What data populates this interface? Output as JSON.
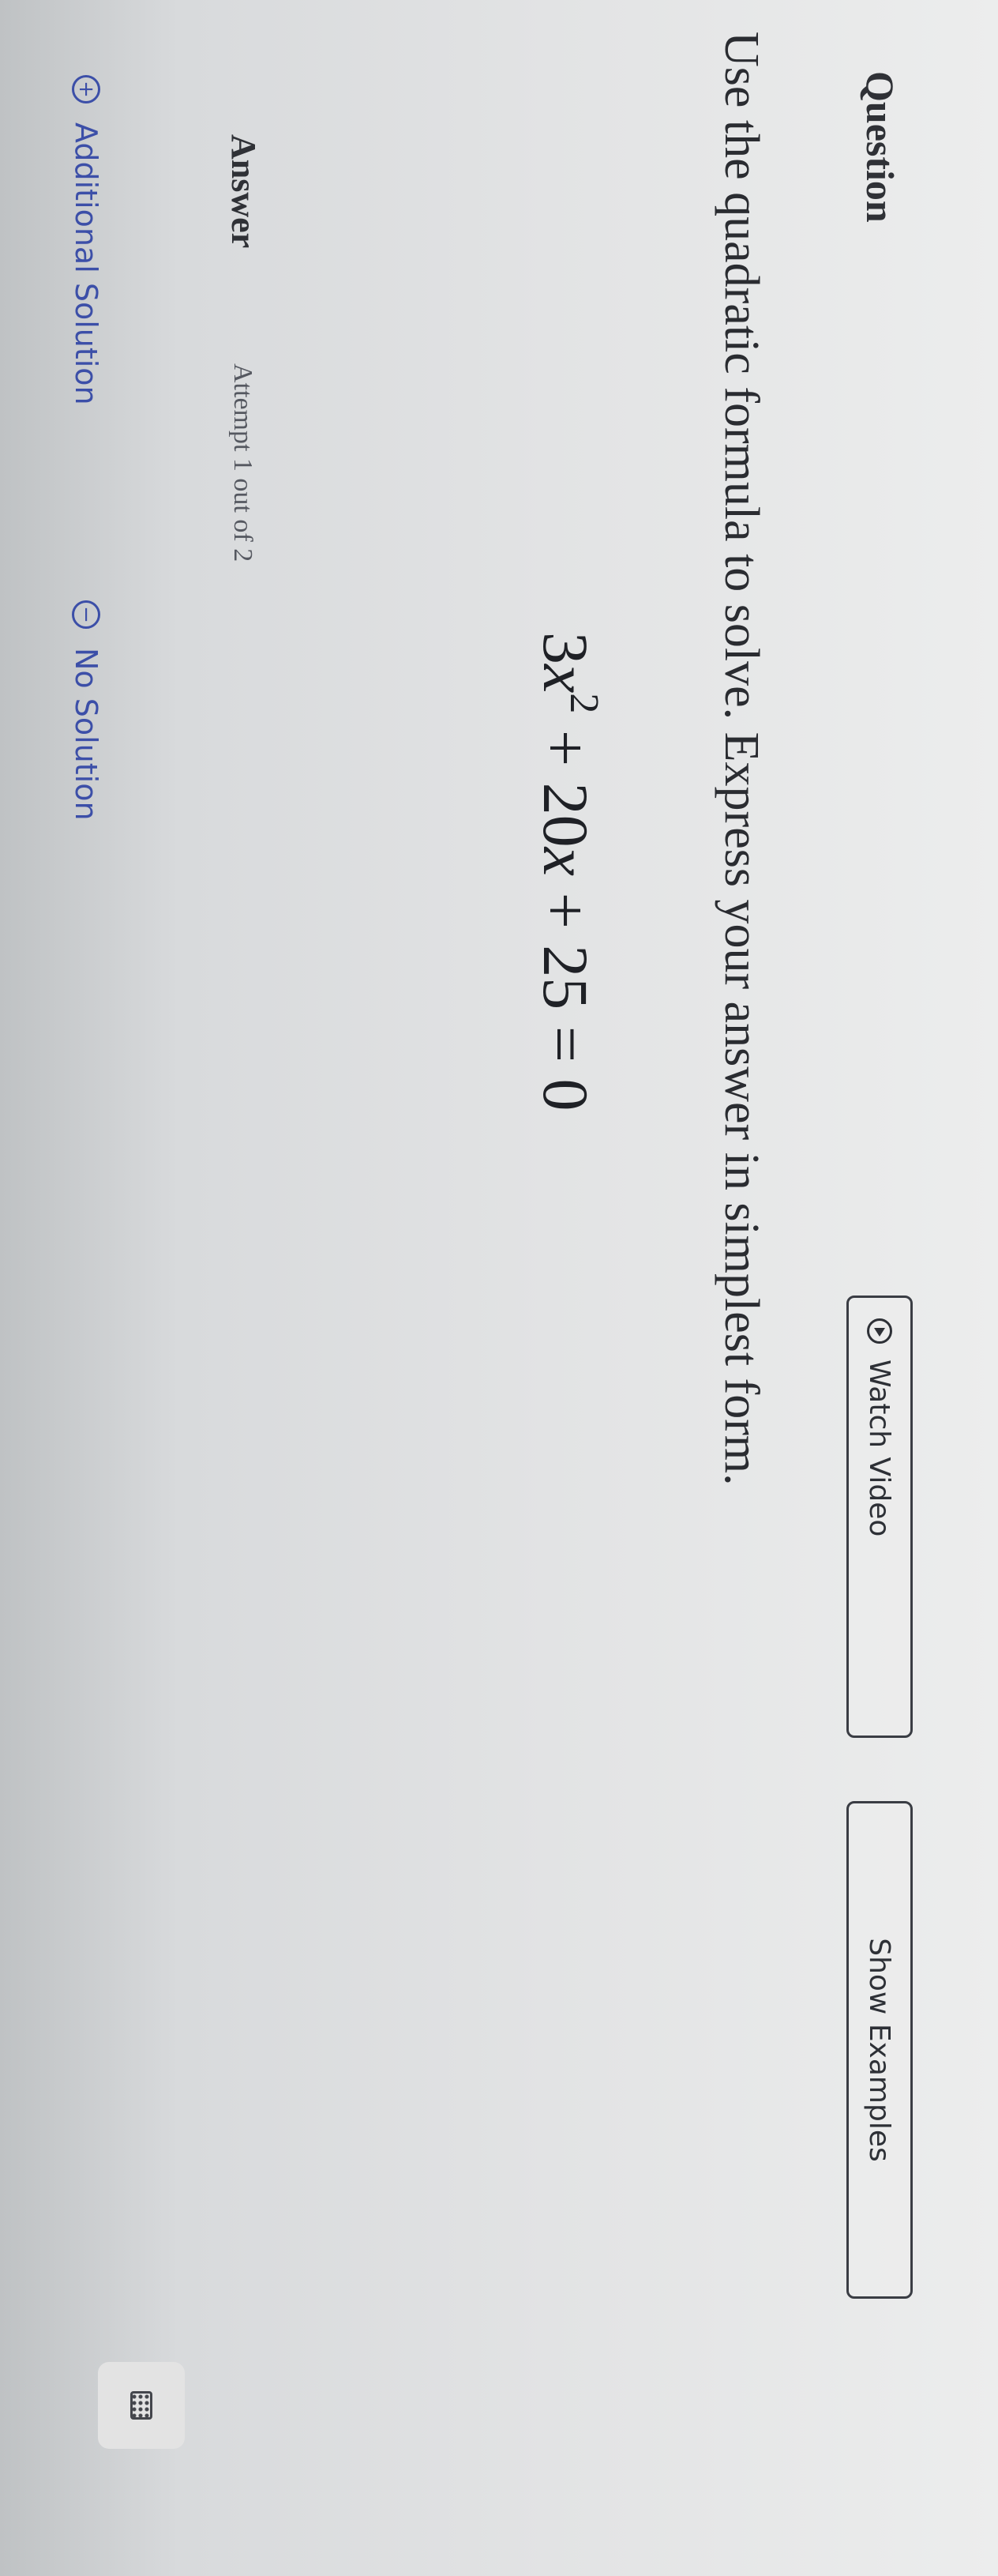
{
  "question": {
    "heading": "Question",
    "watch_video_label": "Watch Video",
    "show_examples_label": "Show Examples",
    "prompt": "Use the quadratic formula to solve. Express your answer in simplest form.",
    "equation": {
      "coef_a": "3",
      "var": "x",
      "exponent": "2",
      "rest_1": " + 20",
      "rest_2": " + 25 = 0"
    }
  },
  "answer": {
    "label": "Answer",
    "attempt_text": "Attempt 1 out of 2",
    "options": {
      "additional_solution": "Additional Solution",
      "no_solution": "No Solution",
      "additional_icon": "+",
      "no_solution_icon": "−"
    }
  },
  "icons": {
    "watch_video": "play-circle-icon",
    "additional": "plus-circle-icon",
    "no_solution": "minus-circle-icon",
    "keypad": "keypad-icon"
  },
  "colors": {
    "link": "#3c4fa8",
    "text": "#2b2d31",
    "border": "#3a3d44"
  }
}
